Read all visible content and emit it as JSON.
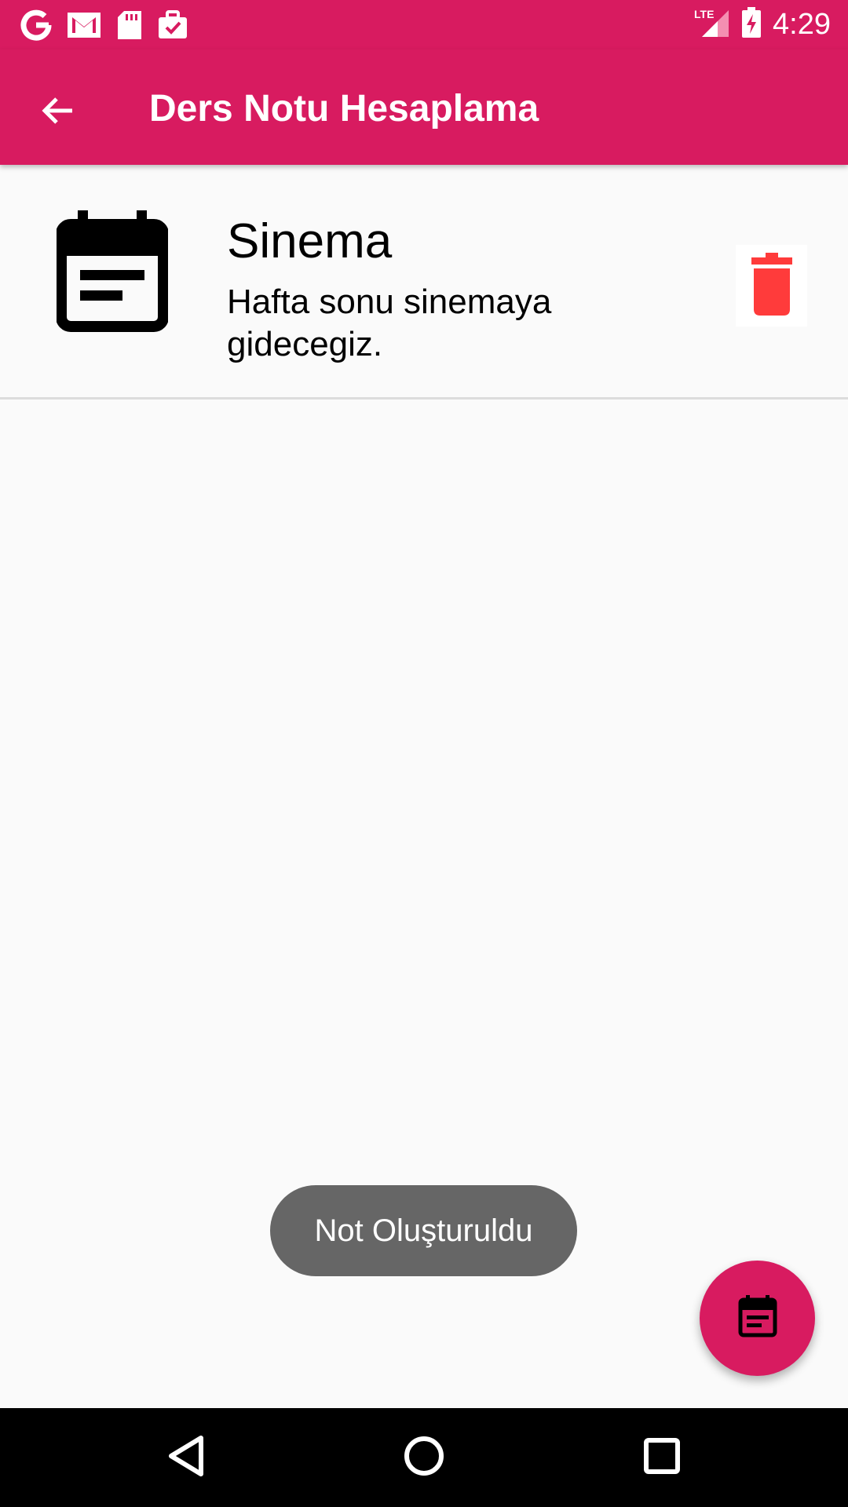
{
  "status_bar": {
    "time": "4:29",
    "network": "LTE",
    "left_icons": [
      "google-icon",
      "gmail-icon",
      "sd-card-icon",
      "briefcase-check-icon"
    ],
    "right_icons": [
      "signal-icon",
      "battery-charging-icon"
    ]
  },
  "app_bar": {
    "title": "Ders Notu Hesaplama",
    "back_icon": "arrow-back-icon",
    "color": "#d81b60"
  },
  "notes": [
    {
      "title": "Sinema",
      "description": "Hafta sonu sinemaya gidecegiz.",
      "icon": "event-note-icon",
      "delete_icon": "trash-icon",
      "delete_color": "#ff3b3b"
    }
  ],
  "toast": {
    "message": "Not Oluşturuldu"
  },
  "fab": {
    "icon": "event-note-icon",
    "color": "#d81b60"
  },
  "nav_bar": {
    "buttons": [
      "back-triangle-icon",
      "home-circle-icon",
      "recents-square-icon"
    ]
  }
}
